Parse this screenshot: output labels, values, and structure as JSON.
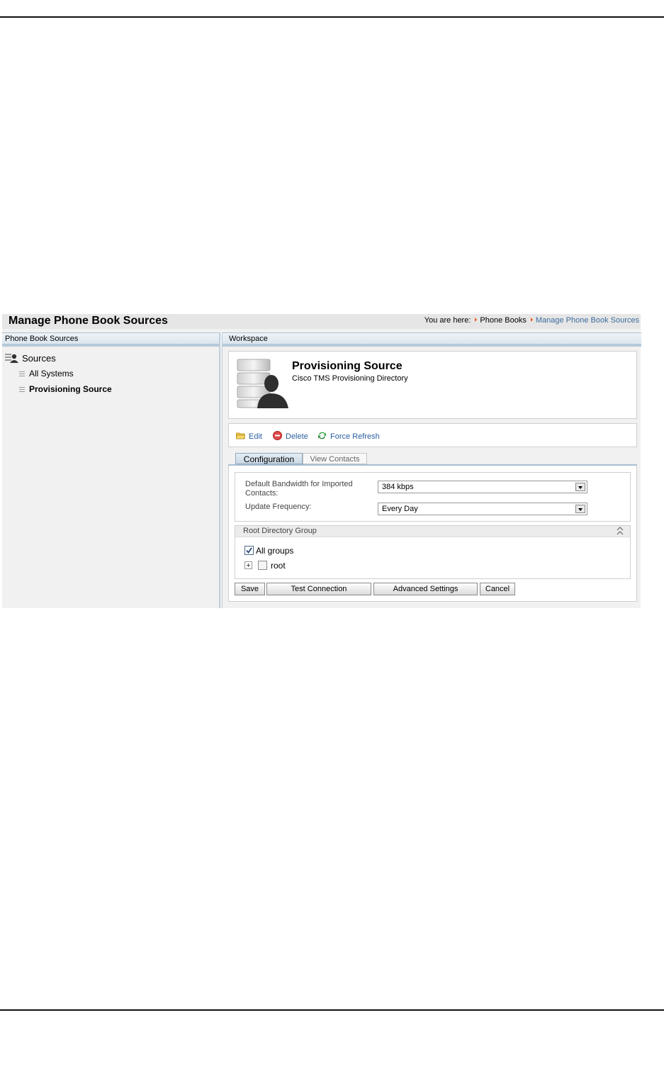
{
  "header": {
    "title": "Manage Phone Book Sources",
    "breadcrumb_label": "You are here:",
    "breadcrumb": [
      "Phone Books",
      "Manage Phone Book Sources"
    ]
  },
  "left_panel": {
    "title": "Phone Book Sources",
    "root_label": "Sources",
    "items": [
      {
        "label": "All Systems",
        "selected": false
      },
      {
        "label": "Provisioning Source",
        "selected": true
      }
    ]
  },
  "workspace": {
    "title": "Workspace",
    "source_name": "Provisioning Source",
    "source_type": "Cisco TMS Provisioning Directory",
    "actions": {
      "edit": "Edit",
      "delete": "Delete",
      "refresh": "Force Refresh"
    },
    "tabs": [
      "Configuration",
      "View Contacts"
    ],
    "active_tab": "Configuration",
    "form": {
      "bandwidth_label": "Default Bandwidth for Imported Contacts:",
      "bandwidth_value": "384 kbps",
      "frequency_label": "Update Frequency:",
      "frequency_value": "Every Day"
    },
    "root_group": {
      "title": "Root Directory Group",
      "all_groups_label": "All groups",
      "all_groups_checked": true,
      "root_label": "root",
      "root_checked": false
    },
    "buttons": {
      "save": "Save",
      "test": "Test Connection",
      "advanced": "Advanced Settings",
      "cancel": "Cancel"
    }
  },
  "colors": {
    "link": "#2b5fa0",
    "breadcrumb_current": "#3d6d9e",
    "breadcrumb_arrow": "#e85a1a",
    "panel_border": "#b5cad9"
  }
}
